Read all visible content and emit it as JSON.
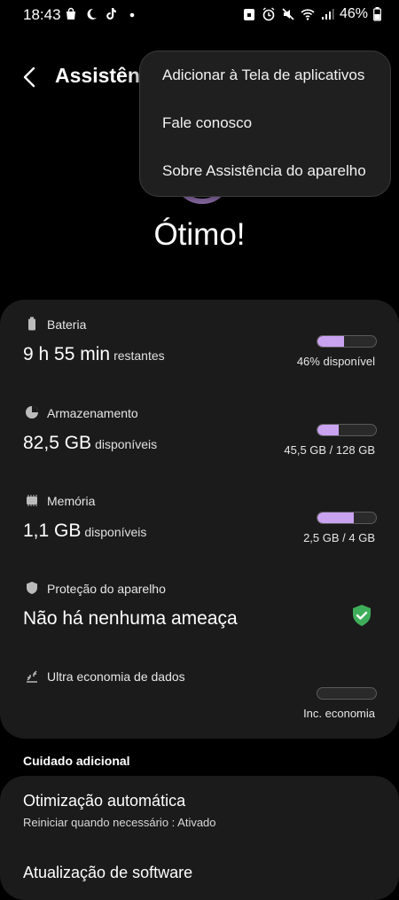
{
  "statusbar": {
    "time": "18:43",
    "battery": "46%"
  },
  "appbar": {
    "title": "Assistência do aparelho"
  },
  "menu": {
    "items": [
      {
        "label": "Adicionar à Tela de aplicativos"
      },
      {
        "label": "Fale conosco"
      },
      {
        "label": "Sobre Assistência do aparelho"
      }
    ]
  },
  "device_status": "Ótimo!",
  "items": {
    "battery": {
      "label": "Bateria",
      "value": "9 h 55 min",
      "suffix": "restantes",
      "bar_fraction": 0.46,
      "caption": "46% disponível"
    },
    "storage": {
      "label": "Armazenamento",
      "value": "82,5 GB",
      "suffix": "disponíveis",
      "bar_fraction": 0.36,
      "caption": "45,5 GB / 128 GB"
    },
    "memory": {
      "label": "Memória",
      "value": "1,1 GB",
      "suffix": "disponíveis",
      "bar_fraction": 0.62,
      "caption": "2,5 GB / 4 GB"
    },
    "protection": {
      "label": "Proteção do aparelho",
      "value": "Não há nenhuma ameaça"
    },
    "data_saver": {
      "label": "Ultra economia de dados",
      "bar_fraction": 0,
      "caption": "Inc. economia"
    }
  },
  "additional": {
    "heading": "Cuidado adicional",
    "auto_opt": {
      "title": "Otimização automática",
      "subtitle": "Reiniciar quando necessário : Ativado"
    },
    "software_update": {
      "title": "Atualização de software"
    }
  },
  "colors": {
    "accent": "#c9a2f0",
    "shield": "#3fae5a",
    "card": "#1b1b1b"
  }
}
